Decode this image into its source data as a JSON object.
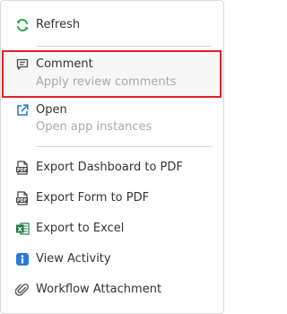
{
  "menu": {
    "items": [
      {
        "label": "Refresh",
        "icon": "refresh-icon"
      },
      {
        "label": "Comment",
        "sublabel": "Apply review comments",
        "icon": "comment-icon"
      },
      {
        "label": "Open",
        "sublabel": "Open app instances",
        "icon": "open-external-icon"
      },
      {
        "label": "Export Dashboard to PDF",
        "icon": "pdf-icon"
      },
      {
        "label": "Export Form to PDF",
        "icon": "pdf-icon"
      },
      {
        "label": "Export to Excel",
        "icon": "excel-icon"
      },
      {
        "label": "View Activity",
        "icon": "info-icon"
      },
      {
        "label": "Workflow Attachment",
        "icon": "paperclip-icon"
      }
    ]
  },
  "colors": {
    "refresh": "#2fa84f",
    "primary": "#2b7bd6",
    "highlight_border": "#e0212b",
    "text": "#333333",
    "subtext": "#a9a9a9"
  }
}
